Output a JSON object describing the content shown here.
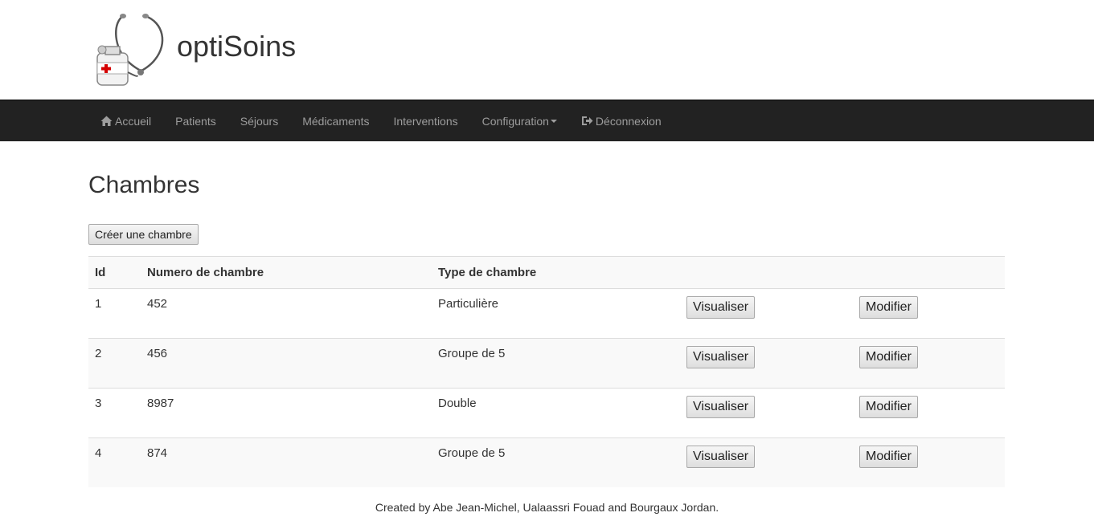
{
  "header": {
    "app_title": "optiSoins"
  },
  "nav": {
    "items": [
      {
        "label": "Accueil",
        "icon": "home-icon"
      },
      {
        "label": "Patients"
      },
      {
        "label": "Séjours"
      },
      {
        "label": "Médicaments"
      },
      {
        "label": "Interventions"
      },
      {
        "label": "Configuration",
        "icon": "caret-down-icon"
      },
      {
        "label": "Déconnexion",
        "icon": "logout-icon"
      }
    ]
  },
  "main": {
    "title": "Chambres",
    "create_button": "Créer une chambre",
    "table": {
      "headers": [
        "Id",
        "Numero de chambre",
        "Type de chambre",
        "",
        ""
      ],
      "rows": [
        {
          "id": "1",
          "numero": "452",
          "type": "Particulière",
          "view": "Visualiser",
          "edit": "Modifier"
        },
        {
          "id": "2",
          "numero": "456",
          "type": "Groupe de 5",
          "view": "Visualiser",
          "edit": "Modifier"
        },
        {
          "id": "3",
          "numero": "8987",
          "type": "Double",
          "view": "Visualiser",
          "edit": "Modifier"
        },
        {
          "id": "4",
          "numero": "874",
          "type": "Groupe de 5",
          "view": "Visualiser",
          "edit": "Modifier"
        }
      ]
    }
  },
  "footer": {
    "text": "Created by Abe Jean-Michel, Ualaassri Fouad and Bourgaux Jordan."
  },
  "colors": {
    "navbar_bg": "#222222",
    "nav_text": "#9d9d9d",
    "stripe": "#f9f9f9"
  }
}
